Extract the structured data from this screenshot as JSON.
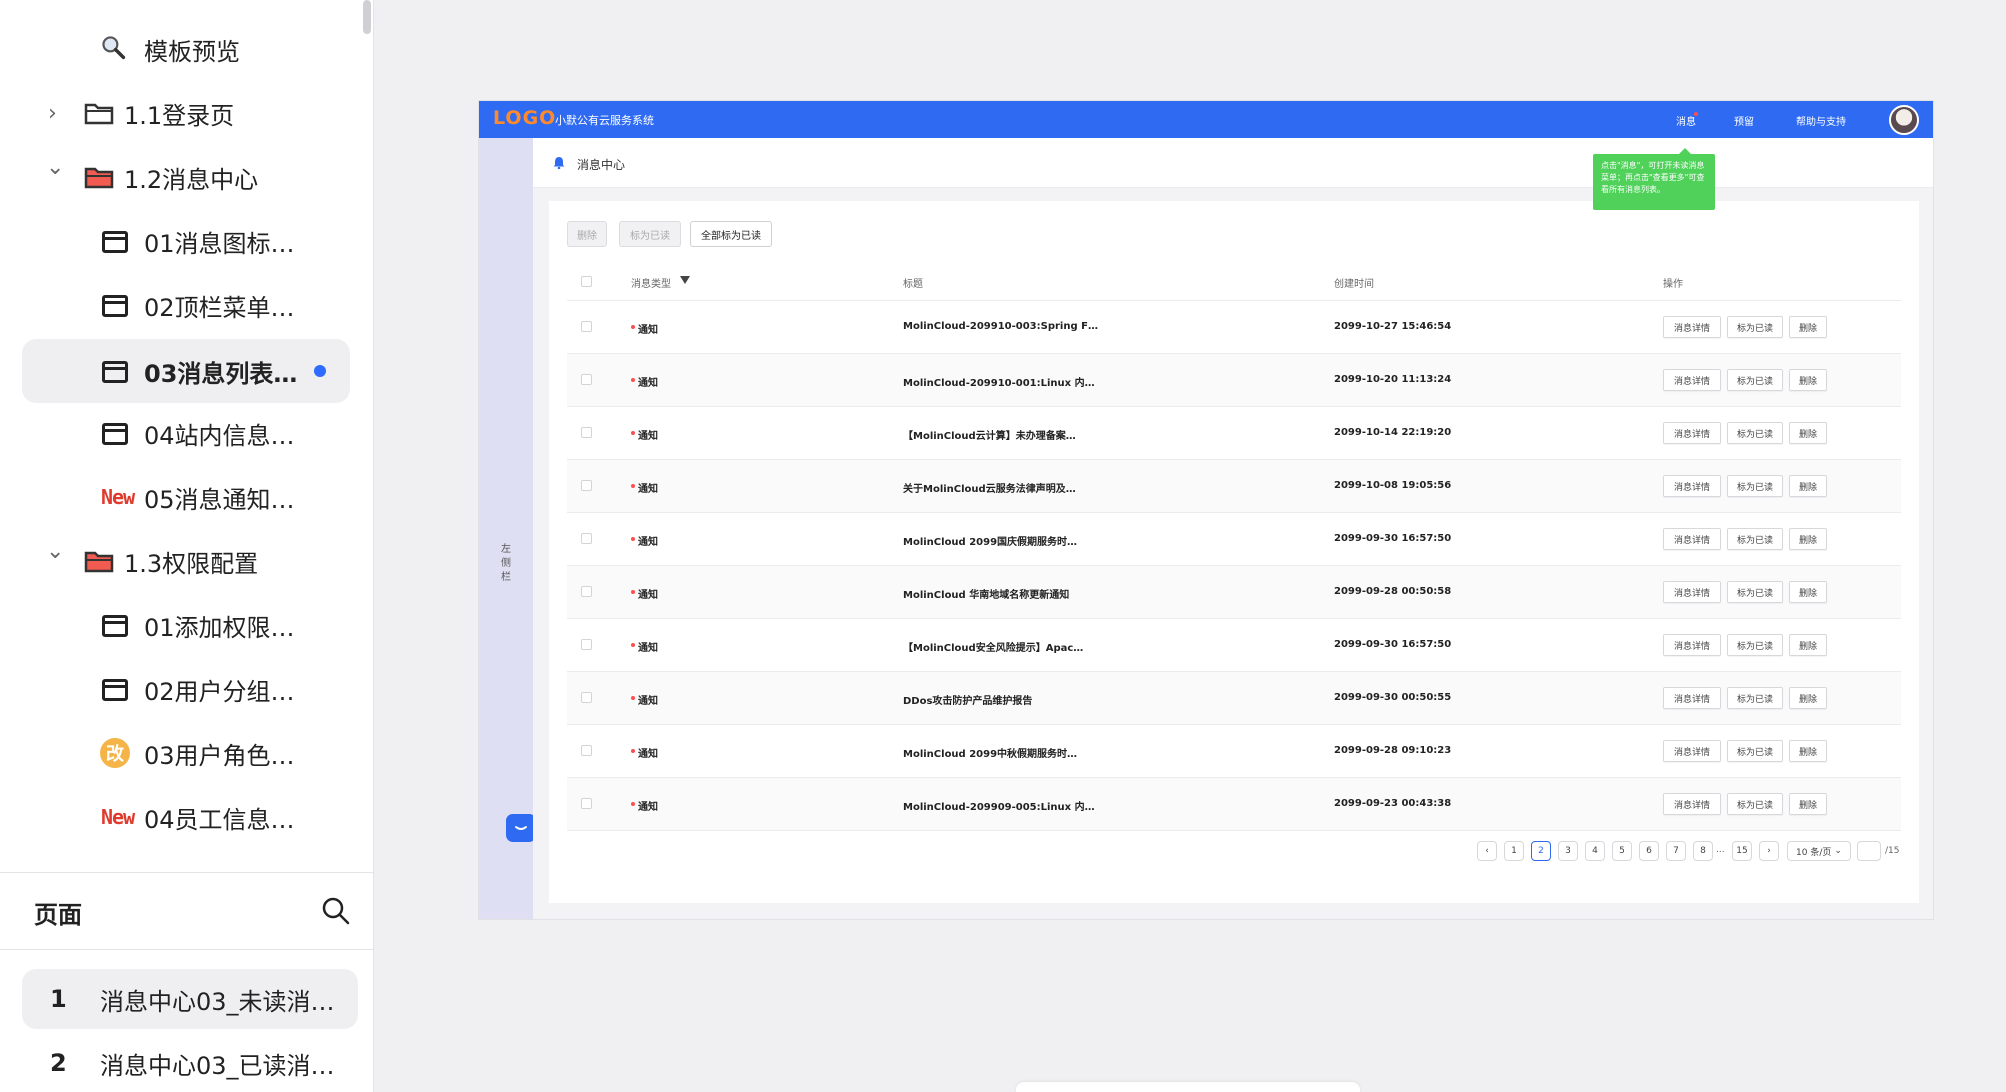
{
  "sidebar": {
    "tree": [
      {
        "label": "模板预览",
        "icon": "magnifier-icon"
      },
      {
        "label": "1.1登录页",
        "icon": "folder-icon",
        "chevron": "›"
      },
      {
        "label": "1.2消息中心",
        "icon": "folder-open-icon",
        "chevron": "⌄"
      },
      {
        "label": "01消息图标…",
        "icon": "frame-icon"
      },
      {
        "label": "02顶栏菜单…",
        "icon": "frame-icon"
      },
      {
        "label": "03消息列表…",
        "icon": "frame-icon"
      },
      {
        "label": "04站内信息…",
        "icon": "frame-icon"
      },
      {
        "label": "05消息通知…",
        "icon": "new-badge-icon",
        "badge": "New"
      },
      {
        "label": "1.3权限配置",
        "icon": "folder-open-icon",
        "chevron": "⌄"
      },
      {
        "label": "01添加权限…",
        "icon": "frame-icon"
      },
      {
        "label": "02用户分组…",
        "icon": "frame-icon"
      },
      {
        "label": "03用户角色…",
        "icon": "modified-badge-icon",
        "badge": "改"
      },
      {
        "label": "04员工信息…",
        "icon": "new-badge-icon",
        "badge": "New"
      }
    ],
    "pages_title": "页面",
    "pages": [
      {
        "num": "1",
        "label": "消息中心03_未读消…"
      },
      {
        "num": "2",
        "label": "消息中心03_已读消…"
      }
    ]
  },
  "app": {
    "logo": "LOGO",
    "system_name": "小默公有云服务系统",
    "nav": {
      "messages": "消息",
      "reserve": "预留",
      "help": "帮助与支持"
    },
    "rail_label": "左侧栏",
    "page_title": "消息中心",
    "tooltip": "点击\"消息\"，可打开未读消息菜单；再点击\"查看更多\"可查看所有消息列表。",
    "toolbar": {
      "delete": "删除",
      "mark_read": "标为已读",
      "mark_all_read": "全部标为已读"
    },
    "columns": {
      "type": "消息类型",
      "title": "标题",
      "created": "创建时间",
      "actions": "操作"
    },
    "actions": {
      "detail": "消息详情",
      "mark_read": "标为已读",
      "delete": "删除"
    },
    "rows": [
      {
        "type": "通知",
        "title": "MolinCloud-209910-003:Spring F…",
        "created": "2099-10-27 15:46:54"
      },
      {
        "type": "通知",
        "title": "MolinCloud-209910-001:Linux 内…",
        "created": "2099-10-20 11:13:24"
      },
      {
        "type": "通知",
        "title": "【MolinCloud云计算】未办理备案…",
        "created": "2099-10-14 22:19:20"
      },
      {
        "type": "通知",
        "title": "关于MolinCloud云服务法律声明及…",
        "created": "2099-10-08 19:05:56"
      },
      {
        "type": "通知",
        "title": "MolinCloud 2099国庆假期服务时…",
        "created": "2099-09-30 16:57:50"
      },
      {
        "type": "通知",
        "title": "MolinCloud 华南地域名称更新通知",
        "created": "2099-09-28 00:50:58"
      },
      {
        "type": "通知",
        "title": "【MolinCloud安全风险提示】Apac…",
        "created": "2099-09-30 16:57:50"
      },
      {
        "type": "通知",
        "title": "DDos攻击防护产品维护报告",
        "created": "2099-09-30 00:50:55"
      },
      {
        "type": "通知",
        "title": "MolinCloud 2099中秋假期服务时…",
        "created": "2099-09-28 09:10:23"
      },
      {
        "type": "通知",
        "title": "MolinCloud-209909-005:Linux 内…",
        "created": "2099-09-23 00:43:38"
      }
    ],
    "pagination": {
      "prev": "‹",
      "pages": [
        "1",
        "2",
        "3",
        "4",
        "5",
        "6",
        "7",
        "8"
      ],
      "current": "2",
      "ellipsis": "...",
      "last": "15",
      "next": "›",
      "page_size": "10 条/页",
      "total": "/15"
    }
  },
  "colors": {
    "brand": "#2f6bf2",
    "logo": "#ff8a2b",
    "tooltip": "#4fd15a",
    "unread_dot": "#ff4d4f",
    "selected_dot": "#2f6bff"
  }
}
